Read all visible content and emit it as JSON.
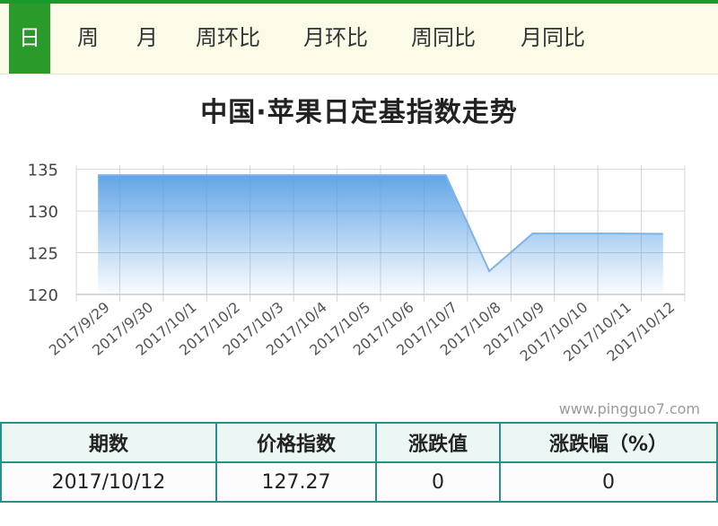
{
  "tabs": [
    {
      "label": "日",
      "active": true
    },
    {
      "label": "周",
      "active": false
    },
    {
      "label": "月",
      "active": false
    },
    {
      "label": "周环比",
      "active": false
    },
    {
      "label": "月环比",
      "active": false
    },
    {
      "label": "周同比",
      "active": false
    },
    {
      "label": "月同比",
      "active": false
    }
  ],
  "colors": {
    "tab_active": "#2a9a2a",
    "top_bar": "#1a9a2a",
    "area_top": "#6aa8e8",
    "line": "#7fb3e6",
    "table_border": "#2a8f8f"
  },
  "watermark": "www.pingguo7.com",
  "chart_data": {
    "type": "area",
    "title": "中国·苹果日定基指数走势",
    "categories": [
      "2017/9/29",
      "2017/9/30",
      "2017/10/1",
      "2017/10/2",
      "2017/10/3",
      "2017/10/4",
      "2017/10/5",
      "2017/10/6",
      "2017/10/7",
      "2017/10/8",
      "2017/10/9",
      "2017/10/10",
      "2017/10/11",
      "2017/10/12"
    ],
    "values": [
      134.3,
      134.3,
      134.3,
      134.3,
      134.3,
      134.3,
      134.3,
      134.3,
      134.3,
      122.8,
      127.3,
      127.3,
      127.3,
      127.27
    ],
    "yticks": [
      120,
      125,
      130,
      135
    ],
    "ylim": [
      120,
      135.5
    ],
    "grid": true,
    "xlabel": "",
    "ylabel": ""
  },
  "table": {
    "headers": [
      "期数",
      "价格指数",
      "涨跌值",
      "涨跌幅（%）"
    ],
    "row": [
      "2017/10/12",
      "127.27",
      "0",
      "0"
    ]
  }
}
